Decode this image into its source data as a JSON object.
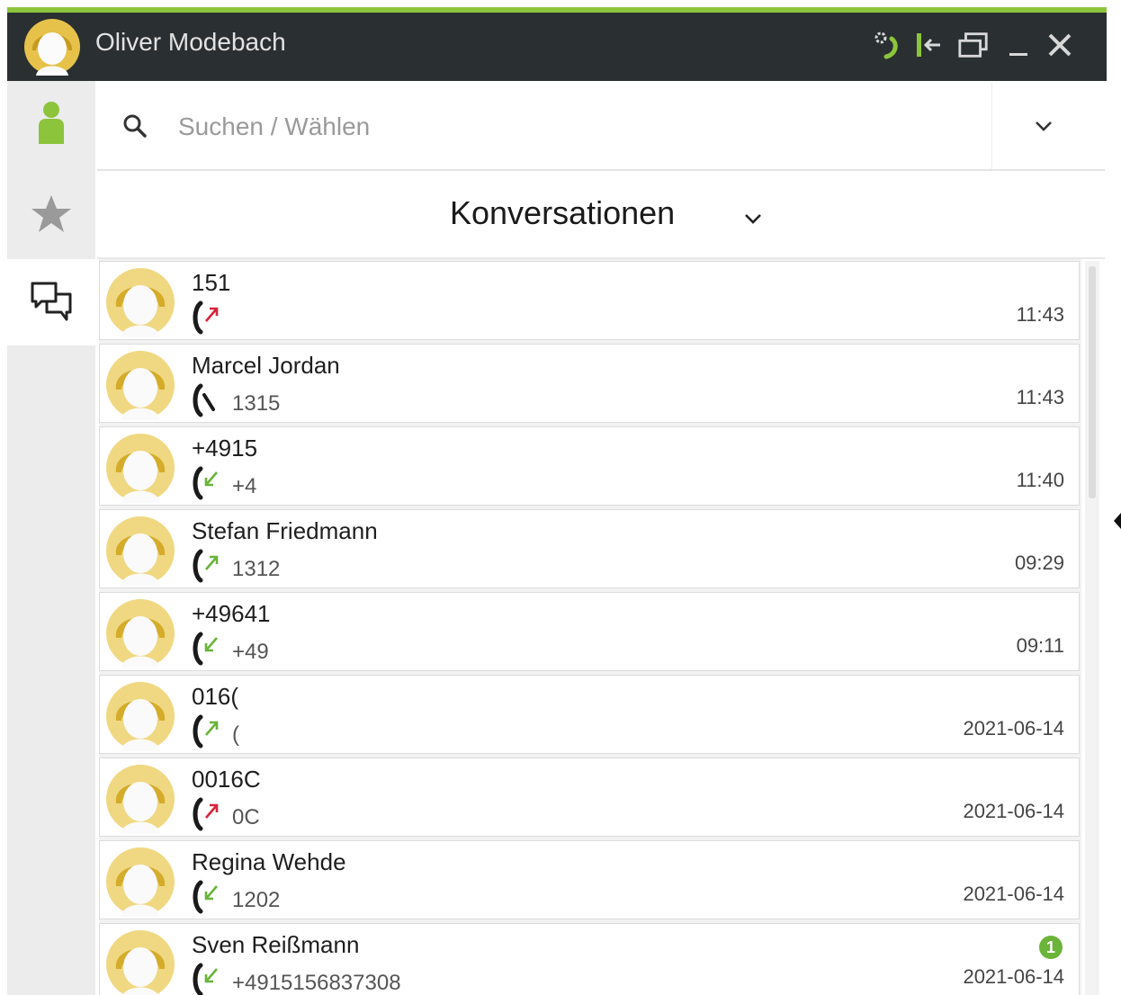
{
  "window": {
    "title": "Oliver Modebach",
    "controls": [
      "phone-settings-icon",
      "dock-icon",
      "restore-icon",
      "minimize-icon",
      "close-icon"
    ]
  },
  "sidebar": {
    "items": [
      {
        "name": "contacts",
        "icon": "person-icon"
      },
      {
        "name": "favorites",
        "icon": "star-icon"
      },
      {
        "name": "conversations",
        "icon": "chat-icon",
        "active": true
      }
    ]
  },
  "search": {
    "placeholder": "Suchen / Wählen",
    "value": ""
  },
  "header": {
    "title": "Konversationen"
  },
  "conversations": [
    {
      "name": "151",
      "number": "",
      "time": "11:43",
      "call_type": "outgoing",
      "badge": ""
    },
    {
      "name": "Marcel Jordan",
      "number": "1315",
      "time": "11:43",
      "call_type": "phone",
      "badge": ""
    },
    {
      "name": "+4915",
      "number": "+4",
      "time": "11:40",
      "call_type": "incoming",
      "badge": ""
    },
    {
      "name": "Stefan Friedmann",
      "number": "1312",
      "time": "09:29",
      "call_type": "outgoing-answered",
      "badge": ""
    },
    {
      "name": "+49641",
      "number": "+49",
      "time": "09:11",
      "call_type": "incoming",
      "badge": ""
    },
    {
      "name": "016(",
      "number": "(",
      "time": "2021-06-14",
      "call_type": "outgoing-answered",
      "badge": ""
    },
    {
      "name": "0016C",
      "number": "0C",
      "time": "2021-06-14",
      "call_type": "outgoing",
      "badge": ""
    },
    {
      "name": "Regina Wehde",
      "number": "1202",
      "time": "2021-06-14",
      "call_type": "incoming",
      "badge": ""
    },
    {
      "name": "Sven Reißmann",
      "number": "+4915156837308",
      "time": "2021-06-14",
      "call_type": "incoming",
      "badge": "1"
    }
  ],
  "colors": {
    "accent": "#8cc43c",
    "titlebar": "#2a2f31",
    "avatar_bg": "#f0d882",
    "avatar_hair": "#d4ac2a",
    "missed_red": "#d8233c",
    "ok_green": "#6ab43a"
  }
}
